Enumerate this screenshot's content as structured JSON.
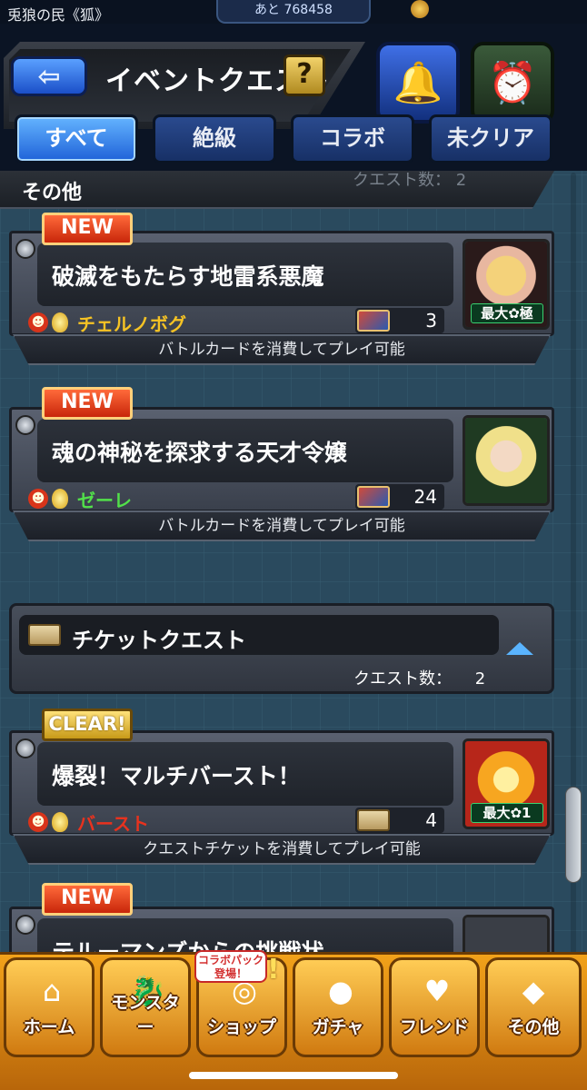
{
  "status": {
    "left_text": "兎狼の民《狐》",
    "center_text": "あと 768458"
  },
  "header": {
    "back_icon": "arrow-left-icon",
    "title": "イベントクエスト",
    "help_label": "?",
    "bell_icon": "bell-icon",
    "clock_icon": "clock-icon"
  },
  "filters": [
    {
      "label": "すべて",
      "active": true
    },
    {
      "label": "絶級",
      "active": false
    },
    {
      "label": "コラボ",
      "active": false
    },
    {
      "label": "未クリア",
      "active": false
    }
  ],
  "sections": {
    "other": {
      "title": "その他",
      "count_label": "クエスト数：",
      "count": "2"
    },
    "ticket": {
      "title": "チケットクエスト",
      "count_label": "クエスト数：",
      "count": "2"
    }
  },
  "quests": [
    {
      "badge": "NEW",
      "title": "破滅をもたらす地雷系悪魔",
      "boss": "チェルノボグ",
      "boss_color": "#f6c324",
      "cost": "3",
      "cost_type": "battle-card",
      "max_label": "最大✿極",
      "note": "バトルカードを消費してプレイ可能",
      "portrait_colors": [
        "#f4d27a",
        "#2a1a1a"
      ]
    },
    {
      "badge": "NEW",
      "title": "魂の神秘を探求する天才令嬢",
      "boss": "ゼーレ",
      "boss_color": "#52e04a",
      "cost": "24",
      "cost_type": "battle-card",
      "note": "バトルカードを消費してプレイ可能",
      "portrait_colors": [
        "#f0e08a",
        "#1f3a22"
      ]
    },
    {
      "badge": "CLEAR!",
      "title": "爆裂！マルチバースト！",
      "boss": "バースト",
      "boss_color": "#e8321e",
      "cost": "4",
      "cost_type": "quest-ticket",
      "max_label": "最大✿1",
      "note": "クエストチケットを消費してプレイ可能",
      "portrait_colors": [
        "#f7a620",
        "#b7261a"
      ]
    },
    {
      "badge": "NEW",
      "title": "テルーマンズからの挑戦状"
    }
  ],
  "nav": [
    {
      "label": "ホーム",
      "icon": "home-icon"
    },
    {
      "label": "モンスター",
      "icon": "monster-icon"
    },
    {
      "label": "ショップ",
      "icon": "shop-icon"
    },
    {
      "label": "ガチャ",
      "icon": "gacha-icon"
    },
    {
      "label": "フレンド",
      "icon": "friends-icon"
    },
    {
      "label": "その他",
      "icon": "other-icon"
    }
  ],
  "collab_tag": "コラボパック\n登場！",
  "alert_mark": "!"
}
